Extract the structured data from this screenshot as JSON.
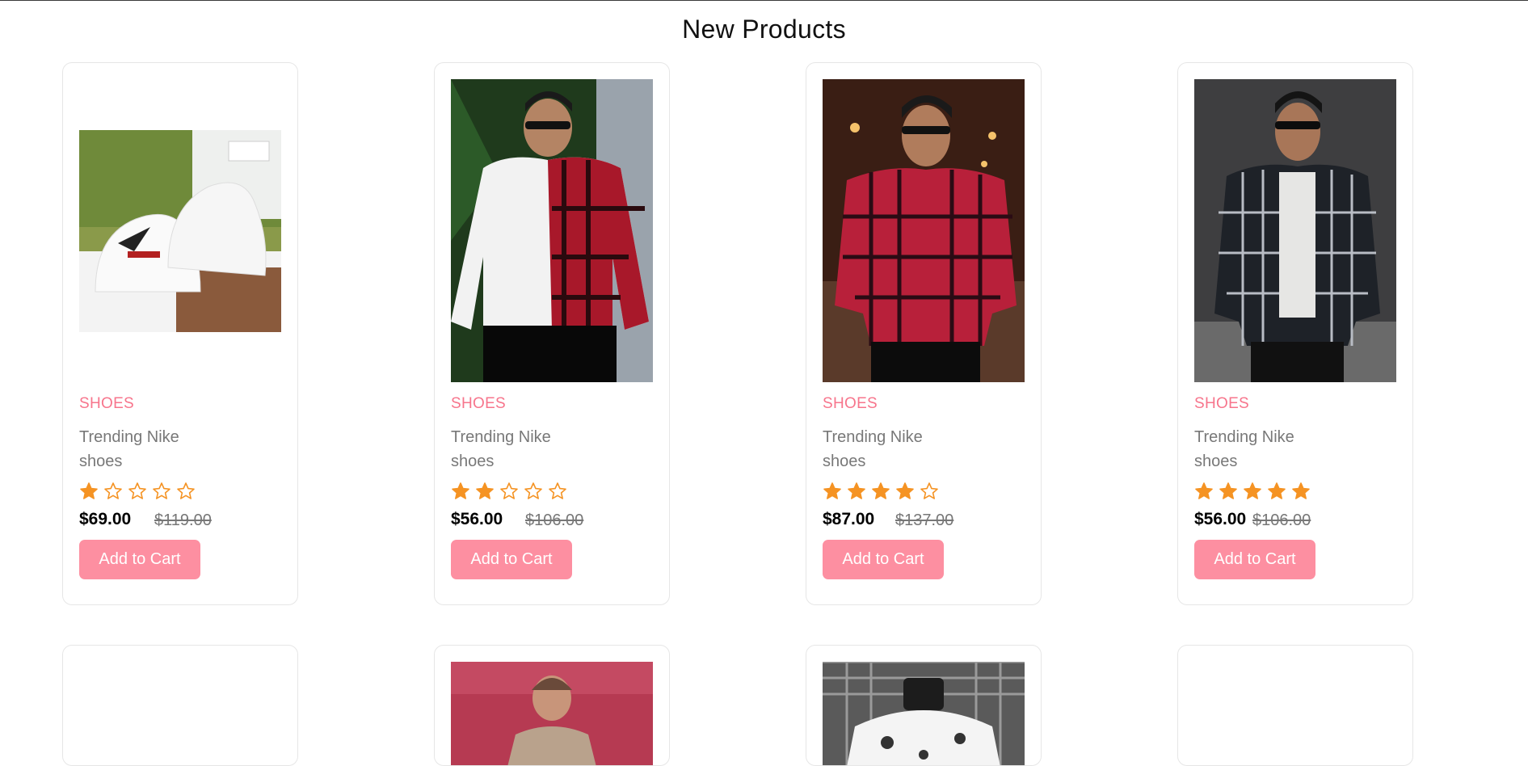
{
  "section": {
    "title": "New Products"
  },
  "products": [
    {
      "category": "SHOES",
      "name": "Trending Nike shoes",
      "rating": 1,
      "max_rating": 5,
      "price": "$69.00",
      "old_price": "$119.00",
      "cart_label": "Add to Cart",
      "image": "white-sneakers-photo"
    },
    {
      "category": "SHOES",
      "name": "Trending Nike shoes",
      "rating": 2,
      "max_rating": 5,
      "price": "$56.00",
      "old_price": "$106.00",
      "cart_label": "Add to Cart",
      "image": "man-half-white-half-plaid-shirt-photo"
    },
    {
      "category": "SHOES",
      "name": "Trending Nike shoes",
      "rating": 4,
      "max_rating": 5,
      "price": "$87.00",
      "old_price": "$137.00",
      "cart_label": "Add to Cart",
      "image": "man-red-plaid-shirt-photo"
    },
    {
      "category": "SHOES",
      "name": "Trending Nike shoes",
      "rating": 5,
      "max_rating": 5,
      "price": "$56.00",
      "old_price": "$106.00",
      "cart_label": "Add to Cart",
      "image": "man-black-plaid-shirt-photo"
    }
  ],
  "second_row": [
    {
      "image": "blank"
    },
    {
      "image": "woman-traditional-dress-photo"
    },
    {
      "image": "white-floral-shirt-photo"
    },
    {
      "image": "blank"
    }
  ],
  "colors": {
    "accent": "#f7758c",
    "button": "#fd8fa1",
    "star": "#f59323",
    "border": "#e6e6e6"
  }
}
